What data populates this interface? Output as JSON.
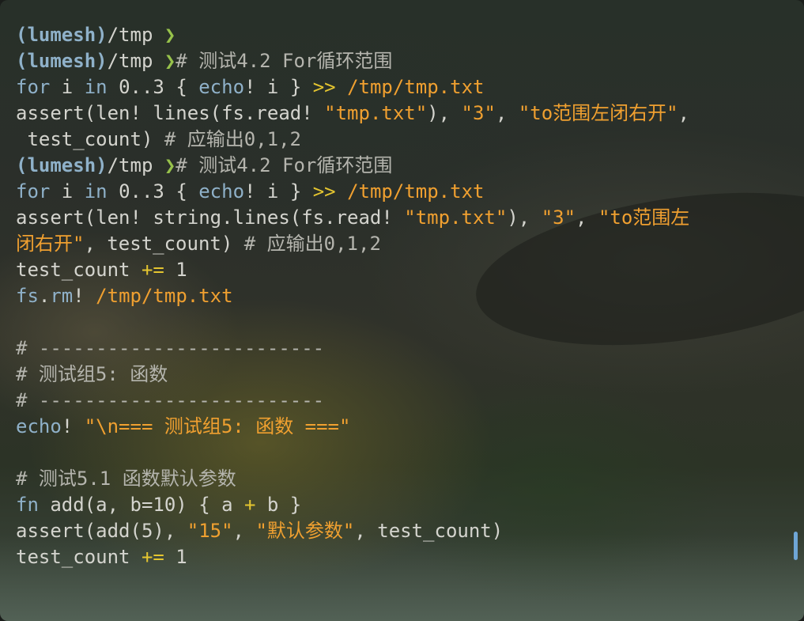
{
  "window": {
    "title": ""
  },
  "terminal": {
    "lines": [
      {
        "t": "prompt",
        "path": "(lumesh)",
        "rest": "/tmp",
        "arrow": " ❯",
        "cmd": ""
      },
      {
        "t": "prompt",
        "path": "(lumesh)",
        "rest": "/tmp",
        "arrow": " ❯",
        "cmd": "# 测试4.2 For循环范围"
      },
      {
        "t": "code",
        "segs": [
          [
            "kw",
            "for"
          ],
          [
            "n",
            " i "
          ],
          [
            "kw",
            "in"
          ],
          [
            "n",
            " 0..3 { "
          ],
          [
            "kw",
            "echo"
          ],
          [
            "n",
            "! i } "
          ],
          [
            "op",
            ">>"
          ],
          [
            "n",
            " "
          ],
          [
            "path",
            "/tmp/tmp.txt"
          ]
        ]
      },
      {
        "t": "code",
        "segs": [
          [
            "n",
            "assert(len! lines(fs.read! "
          ],
          [
            "str",
            "\"tmp.txt\""
          ],
          [
            "n",
            "), "
          ],
          [
            "str",
            "\"3\""
          ],
          [
            "n",
            ", "
          ],
          [
            "str",
            "\"to范围左闭右开\""
          ],
          [
            "n",
            ","
          ]
        ]
      },
      {
        "t": "code",
        "segs": [
          [
            "n",
            " test_count) "
          ],
          [
            "cmt",
            "# 应输出0,1,2"
          ]
        ]
      },
      {
        "t": "prompt",
        "path": "(lumesh)",
        "rest": "/tmp",
        "arrow": " ❯",
        "cmd": "# 测试4.2 For循环范围"
      },
      {
        "t": "code",
        "segs": [
          [
            "kw",
            "for"
          ],
          [
            "n",
            " i "
          ],
          [
            "kw",
            "in"
          ],
          [
            "n",
            " 0..3 { "
          ],
          [
            "kw",
            "echo"
          ],
          [
            "n",
            "! i } "
          ],
          [
            "op",
            ">>"
          ],
          [
            "n",
            " "
          ],
          [
            "path",
            "/tmp/tmp.txt"
          ]
        ]
      },
      {
        "t": "code",
        "segs": [
          [
            "n",
            "assert(len! string.lines(fs.read! "
          ],
          [
            "str",
            "\"tmp.txt\""
          ],
          [
            "n",
            "), "
          ],
          [
            "str",
            "\"3\""
          ],
          [
            "n",
            ", "
          ],
          [
            "str",
            "\"to范围左"
          ]
        ]
      },
      {
        "t": "code",
        "segs": [
          [
            "str",
            "闭右开\""
          ],
          [
            "n",
            ", test_count) "
          ],
          [
            "cmt",
            "# 应输出0,1,2"
          ]
        ]
      },
      {
        "t": "code",
        "segs": [
          [
            "n",
            "test_count "
          ],
          [
            "op",
            "+="
          ],
          [
            "n",
            " 1"
          ]
        ]
      },
      {
        "t": "code",
        "segs": [
          [
            "kw",
            "fs"
          ],
          [
            "n",
            "."
          ],
          [
            "kw",
            "rm"
          ],
          [
            "n",
            "! "
          ],
          [
            "path",
            "/tmp/tmp.txt"
          ]
        ]
      },
      {
        "t": "code",
        "segs": [
          [
            "n",
            ""
          ]
        ]
      },
      {
        "t": "code",
        "segs": [
          [
            "cmt",
            "# -------------------------"
          ]
        ]
      },
      {
        "t": "code",
        "segs": [
          [
            "cmt",
            "# 测试组5: 函数"
          ]
        ]
      },
      {
        "t": "code",
        "segs": [
          [
            "cmt",
            "# -------------------------"
          ]
        ]
      },
      {
        "t": "code",
        "segs": [
          [
            "kw",
            "echo"
          ],
          [
            "n",
            "! "
          ],
          [
            "str",
            "\"\\n=== 测试组5: 函数 ===\""
          ]
        ]
      },
      {
        "t": "code",
        "segs": [
          [
            "n",
            ""
          ]
        ]
      },
      {
        "t": "code",
        "segs": [
          [
            "cmt",
            "# 测试5.1 函数默认参数"
          ]
        ]
      },
      {
        "t": "code",
        "segs": [
          [
            "kw",
            "fn"
          ],
          [
            "n",
            " add(a, b=10) { a "
          ],
          [
            "op",
            "+"
          ],
          [
            "n",
            " b }"
          ]
        ]
      },
      {
        "t": "code",
        "segs": [
          [
            "n",
            "assert(add(5), "
          ],
          [
            "str",
            "\"15\""
          ],
          [
            "n",
            ", "
          ],
          [
            "str",
            "\"默认参数\""
          ],
          [
            "n",
            ", test_count)"
          ]
        ]
      },
      {
        "t": "code",
        "segs": [
          [
            "n",
            "test_count "
          ],
          [
            "op",
            "+="
          ],
          [
            "n",
            " 1"
          ]
        ]
      }
    ]
  },
  "colors": {
    "prompt_path": "#8fb1c9",
    "prompt_arrow": "#97c24b",
    "keyword": "#8fb1c9",
    "operator": "#e4c530",
    "string": "#f0a030",
    "comment": "#b5b5ae",
    "text": "#d4d4ce",
    "scrollbar": "#6fa6d6"
  }
}
